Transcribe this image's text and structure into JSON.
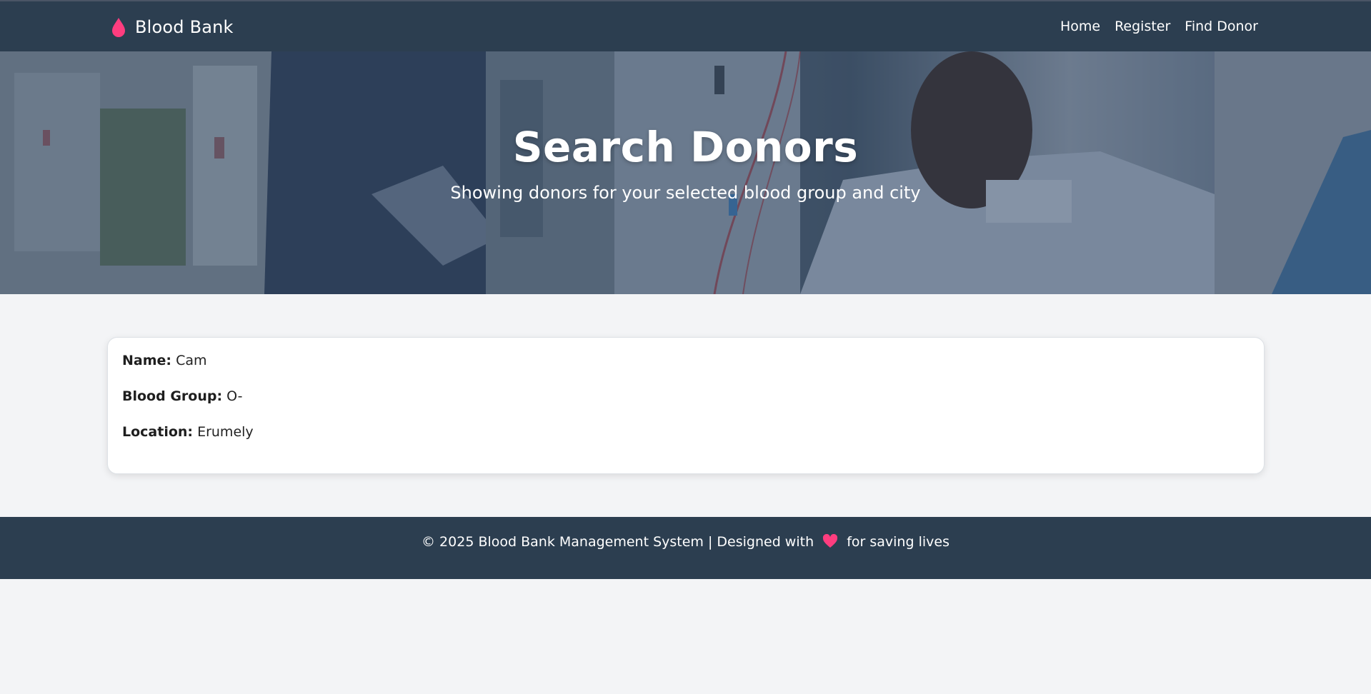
{
  "navbar": {
    "brand": "Blood Bank",
    "brand_icon": "blood-drop-icon",
    "links": [
      "Home",
      "Register",
      "Find Donor"
    ]
  },
  "hero": {
    "title": "Search Donors",
    "subtitle": "Showing donors for your selected blood group and city"
  },
  "donors": [
    {
      "name_label": "Name:",
      "name": "Cam",
      "blood_group_label": "Blood Group:",
      "blood_group": "O-",
      "location_label": "Location:",
      "location": "Erumely"
    }
  ],
  "footer": {
    "text_before": "© 2025 Blood Bank Management System | Designed with",
    "heart_icon": "heart-icon",
    "text_after": "for saving lives"
  },
  "colors": {
    "navbar_bg": "#2c3e50",
    "accent": "#ff3d7f",
    "page_bg": "#f3f4f6"
  }
}
